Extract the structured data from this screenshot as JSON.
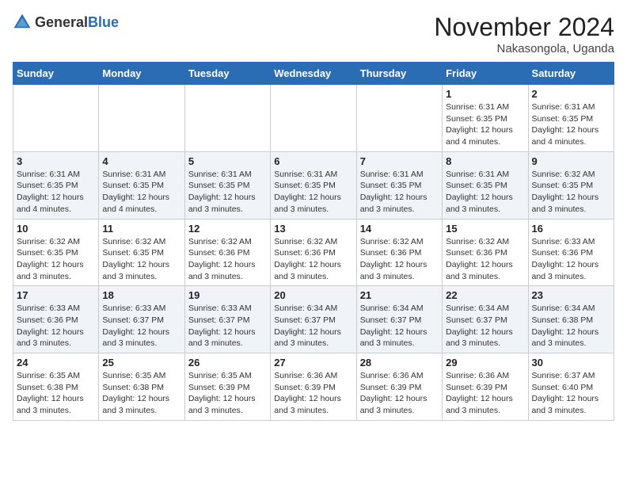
{
  "header": {
    "logo_general": "General",
    "logo_blue": "Blue",
    "month_title": "November 2024",
    "location": "Nakasongola, Uganda"
  },
  "days_of_week": [
    "Sunday",
    "Monday",
    "Tuesday",
    "Wednesday",
    "Thursday",
    "Friday",
    "Saturday"
  ],
  "weeks": [
    [
      {
        "day": "",
        "info": ""
      },
      {
        "day": "",
        "info": ""
      },
      {
        "day": "",
        "info": ""
      },
      {
        "day": "",
        "info": ""
      },
      {
        "day": "",
        "info": ""
      },
      {
        "day": "1",
        "info": "Sunrise: 6:31 AM\nSunset: 6:35 PM\nDaylight: 12 hours and 4 minutes."
      },
      {
        "day": "2",
        "info": "Sunrise: 6:31 AM\nSunset: 6:35 PM\nDaylight: 12 hours and 4 minutes."
      }
    ],
    [
      {
        "day": "3",
        "info": "Sunrise: 6:31 AM\nSunset: 6:35 PM\nDaylight: 12 hours and 4 minutes."
      },
      {
        "day": "4",
        "info": "Sunrise: 6:31 AM\nSunset: 6:35 PM\nDaylight: 12 hours and 4 minutes."
      },
      {
        "day": "5",
        "info": "Sunrise: 6:31 AM\nSunset: 6:35 PM\nDaylight: 12 hours and 3 minutes."
      },
      {
        "day": "6",
        "info": "Sunrise: 6:31 AM\nSunset: 6:35 PM\nDaylight: 12 hours and 3 minutes."
      },
      {
        "day": "7",
        "info": "Sunrise: 6:31 AM\nSunset: 6:35 PM\nDaylight: 12 hours and 3 minutes."
      },
      {
        "day": "8",
        "info": "Sunrise: 6:31 AM\nSunset: 6:35 PM\nDaylight: 12 hours and 3 minutes."
      },
      {
        "day": "9",
        "info": "Sunrise: 6:32 AM\nSunset: 6:35 PM\nDaylight: 12 hours and 3 minutes."
      }
    ],
    [
      {
        "day": "10",
        "info": "Sunrise: 6:32 AM\nSunset: 6:35 PM\nDaylight: 12 hours and 3 minutes."
      },
      {
        "day": "11",
        "info": "Sunrise: 6:32 AM\nSunset: 6:35 PM\nDaylight: 12 hours and 3 minutes."
      },
      {
        "day": "12",
        "info": "Sunrise: 6:32 AM\nSunset: 6:36 PM\nDaylight: 12 hours and 3 minutes."
      },
      {
        "day": "13",
        "info": "Sunrise: 6:32 AM\nSunset: 6:36 PM\nDaylight: 12 hours and 3 minutes."
      },
      {
        "day": "14",
        "info": "Sunrise: 6:32 AM\nSunset: 6:36 PM\nDaylight: 12 hours and 3 minutes."
      },
      {
        "day": "15",
        "info": "Sunrise: 6:32 AM\nSunset: 6:36 PM\nDaylight: 12 hours and 3 minutes."
      },
      {
        "day": "16",
        "info": "Sunrise: 6:33 AM\nSunset: 6:36 PM\nDaylight: 12 hours and 3 minutes."
      }
    ],
    [
      {
        "day": "17",
        "info": "Sunrise: 6:33 AM\nSunset: 6:36 PM\nDaylight: 12 hours and 3 minutes."
      },
      {
        "day": "18",
        "info": "Sunrise: 6:33 AM\nSunset: 6:37 PM\nDaylight: 12 hours and 3 minutes."
      },
      {
        "day": "19",
        "info": "Sunrise: 6:33 AM\nSunset: 6:37 PM\nDaylight: 12 hours and 3 minutes."
      },
      {
        "day": "20",
        "info": "Sunrise: 6:34 AM\nSunset: 6:37 PM\nDaylight: 12 hours and 3 minutes."
      },
      {
        "day": "21",
        "info": "Sunrise: 6:34 AM\nSunset: 6:37 PM\nDaylight: 12 hours and 3 minutes."
      },
      {
        "day": "22",
        "info": "Sunrise: 6:34 AM\nSunset: 6:37 PM\nDaylight: 12 hours and 3 minutes."
      },
      {
        "day": "23",
        "info": "Sunrise: 6:34 AM\nSunset: 6:38 PM\nDaylight: 12 hours and 3 minutes."
      }
    ],
    [
      {
        "day": "24",
        "info": "Sunrise: 6:35 AM\nSunset: 6:38 PM\nDaylight: 12 hours and 3 minutes."
      },
      {
        "day": "25",
        "info": "Sunrise: 6:35 AM\nSunset: 6:38 PM\nDaylight: 12 hours and 3 minutes."
      },
      {
        "day": "26",
        "info": "Sunrise: 6:35 AM\nSunset: 6:39 PM\nDaylight: 12 hours and 3 minutes."
      },
      {
        "day": "27",
        "info": "Sunrise: 6:36 AM\nSunset: 6:39 PM\nDaylight: 12 hours and 3 minutes."
      },
      {
        "day": "28",
        "info": "Sunrise: 6:36 AM\nSunset: 6:39 PM\nDaylight: 12 hours and 3 minutes."
      },
      {
        "day": "29",
        "info": "Sunrise: 6:36 AM\nSunset: 6:39 PM\nDaylight: 12 hours and 3 minutes."
      },
      {
        "day": "30",
        "info": "Sunrise: 6:37 AM\nSunset: 6:40 PM\nDaylight: 12 hours and 3 minutes."
      }
    ]
  ]
}
